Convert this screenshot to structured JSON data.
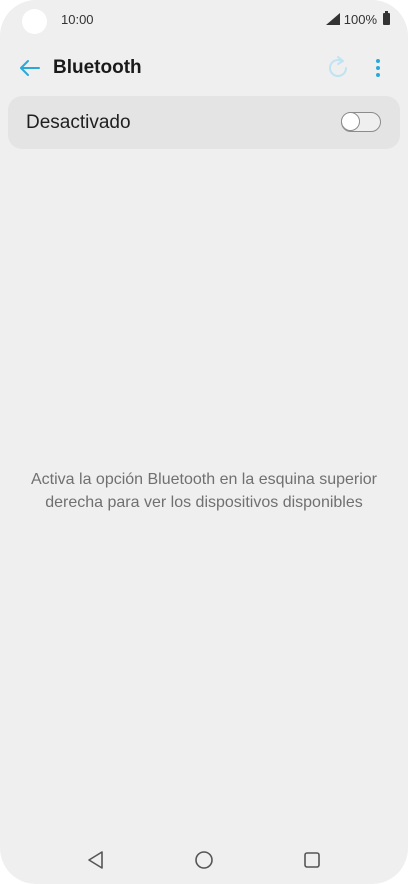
{
  "status_bar": {
    "time": "10:00",
    "battery": "100%"
  },
  "app_bar": {
    "title": "Bluetooth",
    "icons": {
      "back": "arrow-left-icon",
      "refresh": "refresh-icon",
      "more": "more-vert-icon"
    },
    "accent_color": "#2aa9d9",
    "refresh_color": "#bfe3f2"
  },
  "bluetooth_toggle": {
    "label": "Desactivado",
    "state": "off"
  },
  "empty_message": "Activa la opción Bluetooth en la esquina superior derecha para ver los dispositivos disponibles",
  "nav_bar": {
    "icons": [
      "back-triangle-icon",
      "home-circle-icon",
      "recents-square-icon"
    ]
  }
}
